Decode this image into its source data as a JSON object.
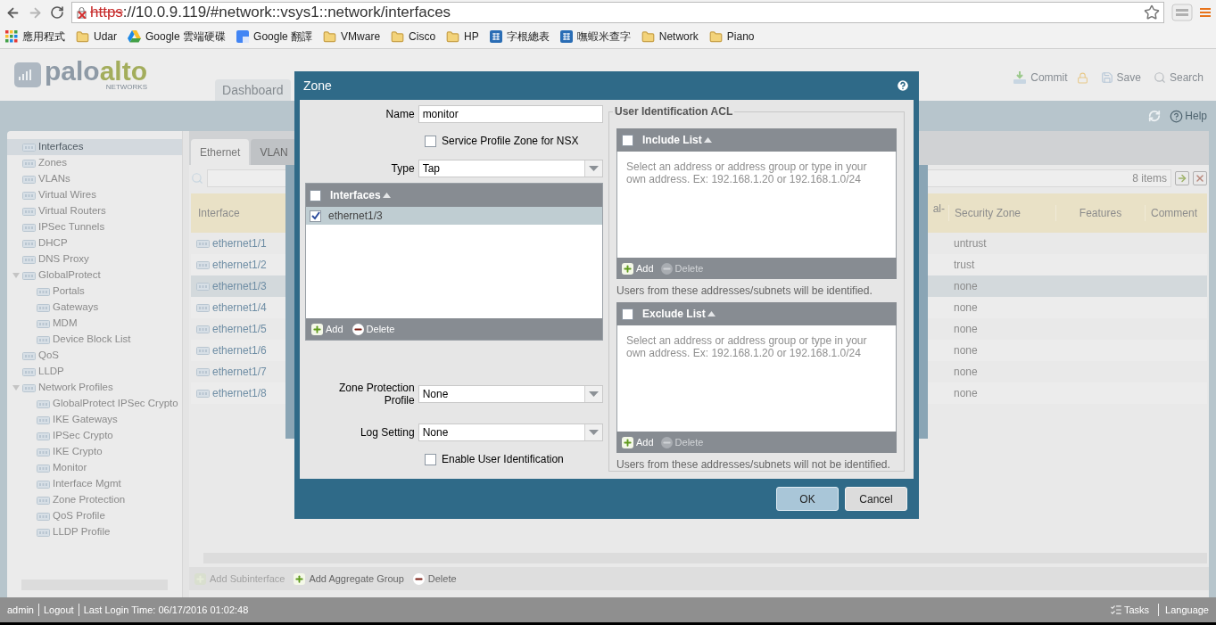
{
  "browser": {
    "url_scheme": "https",
    "url_rest": "://10.0.9.119/#network::vsys1::network/interfaces",
    "bookmarks": [
      {
        "label": "應用程式",
        "kind": "apps"
      },
      {
        "label": "Udar",
        "kind": "folder"
      },
      {
        "label": "Google 雲端硬碟",
        "kind": "drive"
      },
      {
        "label": "Google 翻譯",
        "kind": "translate"
      },
      {
        "label": "VMware",
        "kind": "folder"
      },
      {
        "label": "Cisco",
        "kind": "folder"
      },
      {
        "label": "HP",
        "kind": "folder"
      },
      {
        "label": "字根總表",
        "kind": "dict"
      },
      {
        "label": "嘸蝦米查字",
        "kind": "dict"
      },
      {
        "label": "Network",
        "kind": "folder"
      },
      {
        "label": "Piano",
        "kind": "folder"
      }
    ]
  },
  "app": {
    "logo_palo": "palo",
    "logo_alto": "alto",
    "logo_sub": "NETWORKS",
    "tabs": [
      {
        "label": "Dashboard",
        "selected": false
      }
    ],
    "header_actions": [
      {
        "label": "Commit",
        "kind": "commit"
      },
      {
        "label": "Save",
        "kind": "save"
      },
      {
        "label": "Search",
        "kind": "search"
      }
    ],
    "help": "Help",
    "sidebar": [
      {
        "label": "Interfaces",
        "selected": true
      },
      {
        "label": "Zones",
        "selected": false
      },
      {
        "label": "VLANs",
        "selected": false
      },
      {
        "label": "Virtual Wires",
        "selected": false
      },
      {
        "label": "Virtual Routers",
        "selected": false
      },
      {
        "label": "IPSec Tunnels",
        "selected": false
      },
      {
        "label": "DHCP",
        "selected": false
      },
      {
        "label": "DNS Proxy",
        "selected": false
      },
      {
        "label": "GlobalProtect",
        "selected": false,
        "expanded": true,
        "children": [
          {
            "label": "Portals",
            "selected": false
          },
          {
            "label": "Gateways",
            "selected": false
          },
          {
            "label": "MDM",
            "selected": false
          },
          {
            "label": "Device Block List",
            "selected": false
          }
        ]
      },
      {
        "label": "QoS",
        "selected": false
      },
      {
        "label": "LLDP",
        "selected": false
      },
      {
        "label": "Network Profiles",
        "selected": false,
        "expanded": true,
        "children": [
          {
            "label": "GlobalProtect IPSec Crypto",
            "selected": false
          },
          {
            "label": "IKE Gateways",
            "selected": false
          },
          {
            "label": "IPSec Crypto",
            "selected": false
          },
          {
            "label": "IKE Crypto",
            "selected": false
          },
          {
            "label": "Monitor",
            "selected": false
          },
          {
            "label": "Interface Mgmt",
            "selected": false
          },
          {
            "label": "Zone Protection",
            "selected": false
          },
          {
            "label": "QoS Profile",
            "selected": false
          },
          {
            "label": "LLDP Profile",
            "selected": false
          }
        ]
      }
    ],
    "main_tabs": [
      {
        "label": "Ethernet",
        "selected": true
      },
      {
        "label": "VLAN",
        "selected": false
      }
    ],
    "item_count": "8 items",
    "table": {
      "columns": [
        "Interface",
        "al-",
        "Security Zone",
        "Features",
        "Comment"
      ],
      "rows": [
        {
          "interface": "ethernet1/1",
          "security_zone": "untrust",
          "selected": false
        },
        {
          "interface": "ethernet1/2",
          "security_zone": "trust",
          "selected": false
        },
        {
          "interface": "ethernet1/3",
          "security_zone": "none",
          "selected": true
        },
        {
          "interface": "ethernet1/4",
          "security_zone": "none",
          "selected": false
        },
        {
          "interface": "ethernet1/5",
          "security_zone": "none",
          "selected": false
        },
        {
          "interface": "ethernet1/6",
          "security_zone": "none",
          "selected": false
        },
        {
          "interface": "ethernet1/7",
          "security_zone": "none",
          "selected": false
        },
        {
          "interface": "ethernet1/8",
          "security_zone": "none",
          "selected": false
        }
      ]
    },
    "bottom_actions": [
      {
        "label": "Add Subinterface",
        "kind": "add",
        "disabled": true
      },
      {
        "label": "Add Aggregate Group",
        "kind": "add",
        "disabled": false
      },
      {
        "label": "Delete",
        "kind": "delete",
        "disabled": false
      }
    ],
    "status_bar": {
      "left": [
        "admin",
        "Logout",
        "Last Login Time: 06/17/2016 01:02:48"
      ],
      "right": [
        {
          "label": "Tasks",
          "kind": "tasks"
        },
        {
          "label": "Language",
          "kind": "language"
        }
      ]
    }
  },
  "dialog": {
    "title": "Zone",
    "name": {
      "label": "Name",
      "value": "monitor"
    },
    "nsx": {
      "label": "Service Profile Zone for NSX",
      "checked": false
    },
    "type": {
      "label": "Type",
      "value": "Tap"
    },
    "interfaces": {
      "header": "Interfaces",
      "all_checked": false,
      "rows": [
        {
          "name": "ethernet1/3",
          "checked": true,
          "selected": true
        }
      ],
      "actions": [
        {
          "label": "Add",
          "kind": "add",
          "disabled": false
        },
        {
          "label": "Delete",
          "kind": "delete",
          "disabled": false
        }
      ]
    },
    "zone_protection": {
      "label": "Zone Protection Profile",
      "value": "None"
    },
    "log_setting": {
      "label": "Log Setting",
      "value": "None"
    },
    "enable_user_id": {
      "label": "Enable User Identification",
      "checked": false
    },
    "acl": {
      "title": "User Identification ACL",
      "lists": [
        {
          "header": "Include List",
          "all_checked": false,
          "placeholder": "Select an address or address group or type in your own address. Ex: 192.168.1.20 or 192.168.1.0/24",
          "actions": [
            {
              "label": "Add",
              "kind": "add",
              "disabled": false
            },
            {
              "label": "Delete",
              "kind": "delete",
              "disabled": true
            }
          ],
          "note": "Users from these addresses/subnets will be identified."
        },
        {
          "header": "Exclude List",
          "all_checked": false,
          "placeholder": "Select an address or address group or type in your own address. Ex: 192.168.1.20 or 192.168.1.0/24",
          "actions": [
            {
              "label": "Add",
              "kind": "add",
              "disabled": false
            },
            {
              "label": "Delete",
              "kind": "delete",
              "disabled": true
            }
          ],
          "note": "Users from these addresses/subnets will not be identified."
        }
      ]
    },
    "buttons": [
      {
        "label": "OK",
        "primary": true
      },
      {
        "label": "Cancel",
        "primary": false
      }
    ]
  }
}
